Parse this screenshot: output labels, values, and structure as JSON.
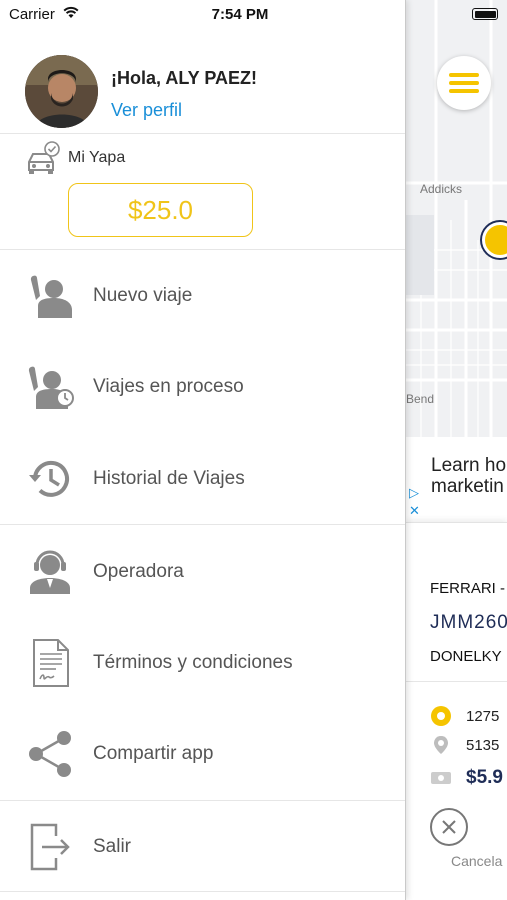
{
  "status_bar": {
    "carrier": "Carrier",
    "time": "7:54 PM"
  },
  "drawer": {
    "greeting": "¡Hola, ALY PAEZ!",
    "profile_link": "Ver perfil",
    "wallet": {
      "title": "Mi Yapa",
      "balance": "$25.0"
    },
    "menu": [
      {
        "label": "Nuevo viaje",
        "icon": "raised-hand-person-icon"
      },
      {
        "label": "Viajes en proceso",
        "icon": "person-clock-icon"
      },
      {
        "label": "Historial de Viajes",
        "icon": "history-clock-icon"
      },
      {
        "label": "Operadora",
        "icon": "headset-operator-icon"
      },
      {
        "label": "Términos y condiciones",
        "icon": "document-signature-icon"
      },
      {
        "label": "Compartir app",
        "icon": "share-icon"
      },
      {
        "label": "Salir",
        "icon": "exit-icon"
      }
    ]
  },
  "background": {
    "map_labels": [
      "Addicks",
      "Bend"
    ],
    "ad_text": "Learn ho\nmarketin",
    "trip": {
      "car": "FERRARI -",
      "plate": "JMM260",
      "driver": "DONELKY",
      "origin": "1275",
      "destination": "5135",
      "fare": "$5.9",
      "cancel_label": "Cancela"
    }
  },
  "colors": {
    "accent": "#f0c419",
    "link": "#1a8fd8",
    "navy": "#1f2d57",
    "icon_gray": "#8a8a8a"
  }
}
